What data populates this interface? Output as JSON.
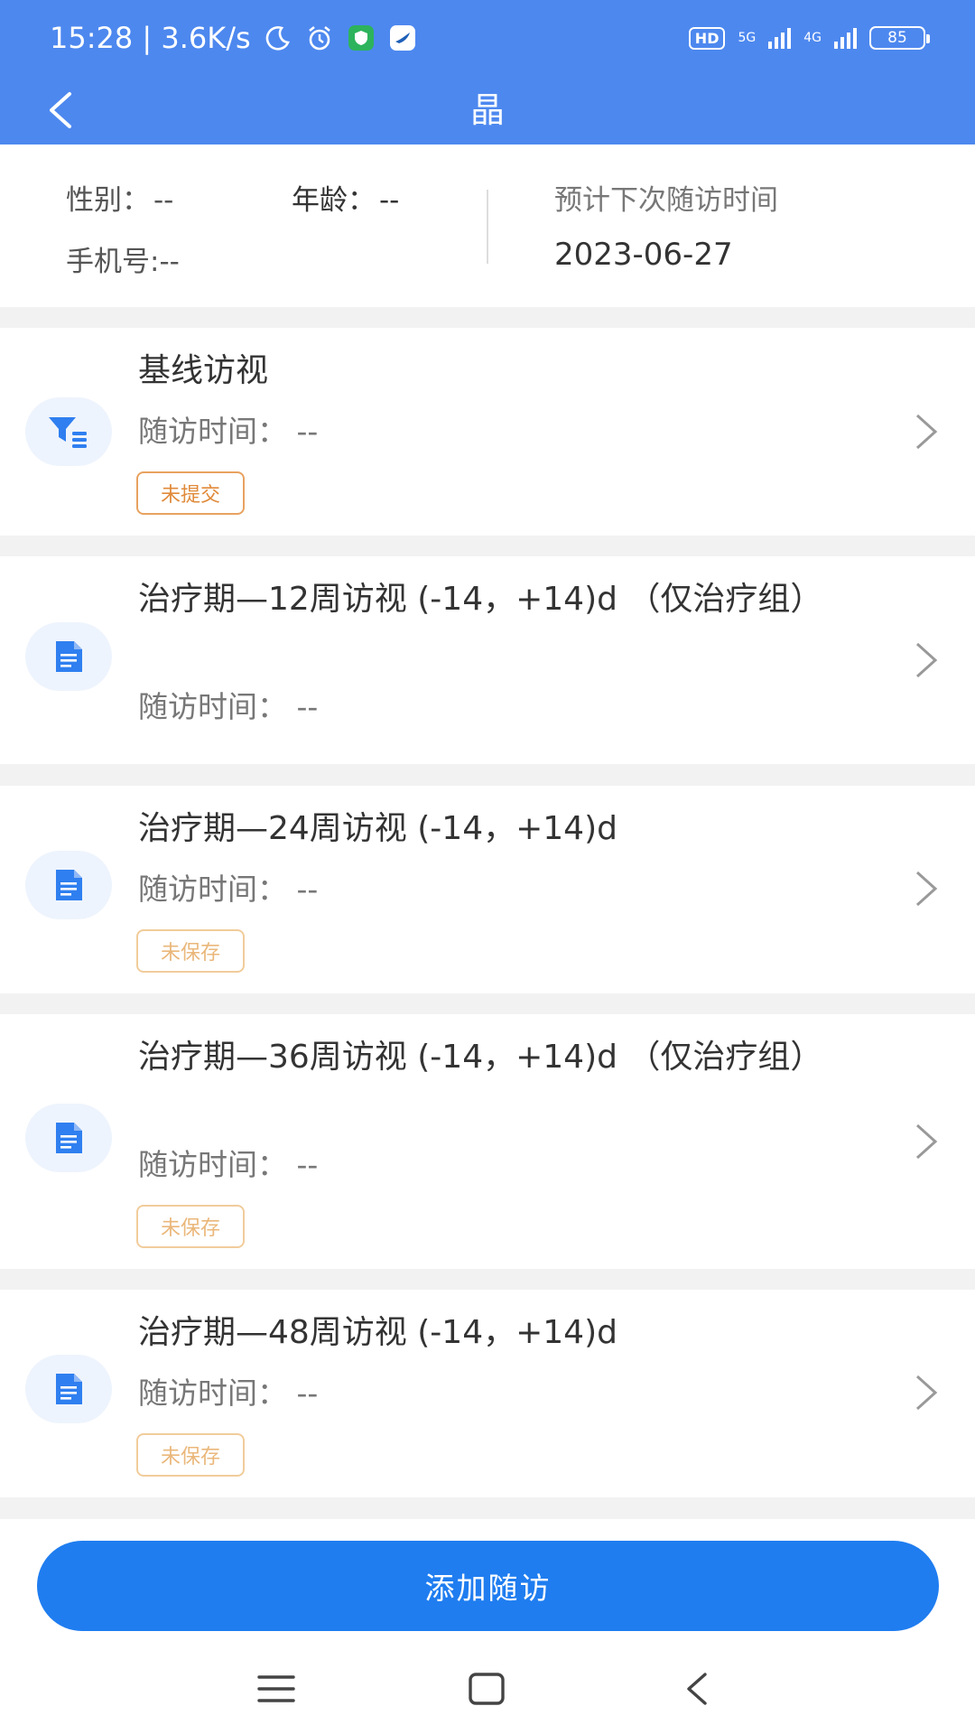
{
  "status_bar": {
    "time_speed": "15:28 | 3.6K/s",
    "hd_label": "HD",
    "net1": "5G",
    "net2": "4G",
    "battery": "85"
  },
  "header": {
    "title": "晶",
    "back_icon": "back-arrow-icon"
  },
  "patient": {
    "gender_label": "性别：",
    "gender_value": "--",
    "age_label": "年龄：",
    "age_value": "--",
    "phone": "手机号:--",
    "next_visit_label": "预计下次随访时间",
    "next_visit_date": "2023-06-27"
  },
  "visits": [
    {
      "title": "基线访视",
      "time": "随访时间：  --",
      "icon": "filter-list-icon",
      "status": "未提交"
    },
    {
      "title": "治疗期—12周访视 (-14，+14)d （仅治疗组）",
      "time": "随访时间：  --",
      "icon": "document-icon",
      "status": ""
    },
    {
      "title": "治疗期—24周访视 (-14，+14)d",
      "time": "随访时间：  --",
      "icon": "document-icon",
      "status": "未保存"
    },
    {
      "title": "治疗期—36周访视 (-14，+14)d （仅治疗组）",
      "time": "随访时间：  --",
      "icon": "document-icon",
      "status": "未保存"
    },
    {
      "title": "治疗期—48周访视 (-14，+14)d",
      "time": "随访时间：  --",
      "icon": "document-icon",
      "status": "未保存"
    }
  ],
  "add_button": "添加随访",
  "colors": {
    "header": "#4d88ef",
    "primary_button": "#1f7df0",
    "tag_orange": "#e08a3a",
    "icon_blue": "#2f7ff0"
  }
}
